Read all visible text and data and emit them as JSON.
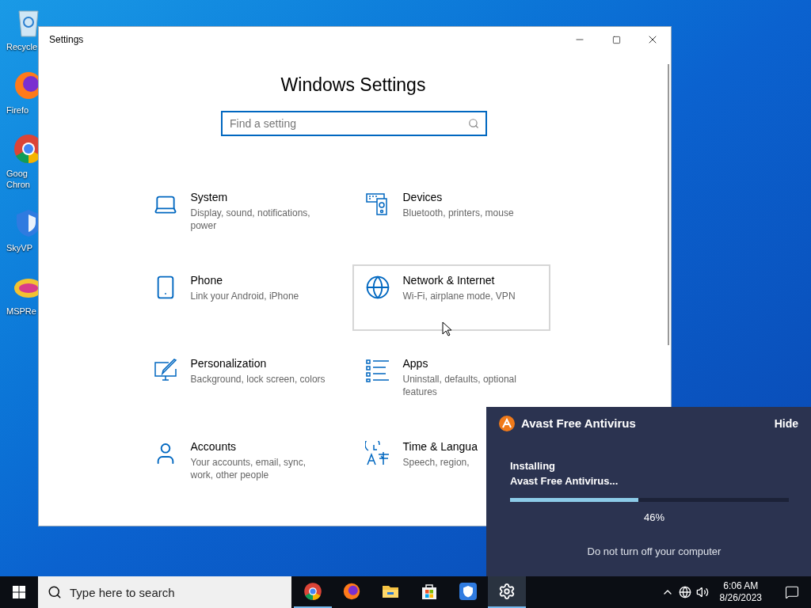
{
  "desktop_icons": [
    {
      "kind": "recycle",
      "label": [
        "Recycle"
      ]
    },
    {
      "kind": "firefox",
      "label": [
        "Firefo"
      ]
    },
    {
      "kind": "chrome",
      "label": [
        "Goog",
        "Chron"
      ]
    },
    {
      "kind": "skyvpn",
      "label": [
        "SkyVP"
      ]
    },
    {
      "kind": "game",
      "label": [
        "MSPRe"
      ]
    }
  ],
  "window": {
    "title": "Settings",
    "heading": "Windows Settings",
    "search": {
      "placeholder": "Find a setting"
    },
    "tiles": [
      {
        "kind": "system",
        "title": "System",
        "subtitle": "Display, sound, notifications, power",
        "selected": false
      },
      {
        "kind": "devices",
        "title": "Devices",
        "subtitle": "Bluetooth, printers, mouse",
        "selected": false
      },
      {
        "kind": "phone",
        "title": "Phone",
        "subtitle": "Link your Android, iPhone",
        "selected": false
      },
      {
        "kind": "network",
        "title": "Network & Internet",
        "subtitle": "Wi-Fi, airplane mode, VPN",
        "selected": true
      },
      {
        "kind": "personalization",
        "title": "Personalization",
        "subtitle": "Background, lock screen, colors",
        "selected": false
      },
      {
        "kind": "apps",
        "title": "Apps",
        "subtitle": "Uninstall, defaults, optional features",
        "selected": false
      },
      {
        "kind": "accounts",
        "title": "Accounts",
        "subtitle": "Your accounts, email, sync, work, other people",
        "selected": false
      },
      {
        "kind": "time",
        "title": "Time & Langua",
        "subtitle": "Speech, region,",
        "selected": false
      }
    ]
  },
  "popup": {
    "title": "Avast Free Antivirus",
    "hide": "Hide",
    "status": [
      "Installing",
      "Avast Free Antivirus..."
    ],
    "level": 0.46,
    "percent": "46%",
    "note": "Do not turn off your computer"
  },
  "taskbar": {
    "search": {
      "placeholder": "Type here to search"
    },
    "apps": [
      {
        "kind": "chrome",
        "running": true,
        "selected": false
      },
      {
        "kind": "firefox",
        "running": false,
        "selected": false
      },
      {
        "kind": "files",
        "running": false,
        "selected": false
      },
      {
        "kind": "store",
        "running": false,
        "selected": false
      },
      {
        "kind": "skyvpn",
        "running": false,
        "selected": false
      },
      {
        "kind": "settings",
        "running": true,
        "selected": true
      }
    ],
    "time": "6:06 AM",
    "date": "8/26/2023"
  }
}
